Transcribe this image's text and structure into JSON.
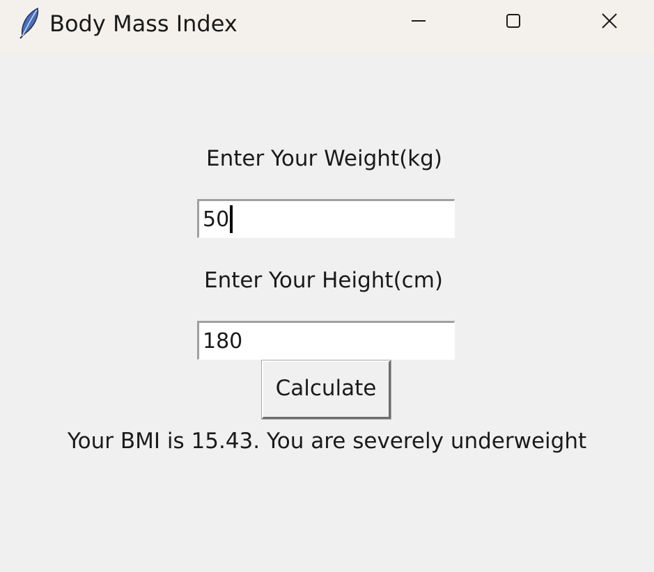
{
  "window": {
    "title": "Body Mass Index",
    "icon": "feather-icon",
    "controls": [
      "minimize-icon",
      "maximize-icon",
      "close-icon"
    ]
  },
  "form": {
    "weight_label": "Enter Your Weight(kg)",
    "weight_value": "50",
    "height_label": "Enter Your Height(cm)",
    "height_value": "180",
    "calculate_label": "Calculate"
  },
  "result": {
    "text": "Your BMI is 15.43. You are severely underweight"
  }
}
